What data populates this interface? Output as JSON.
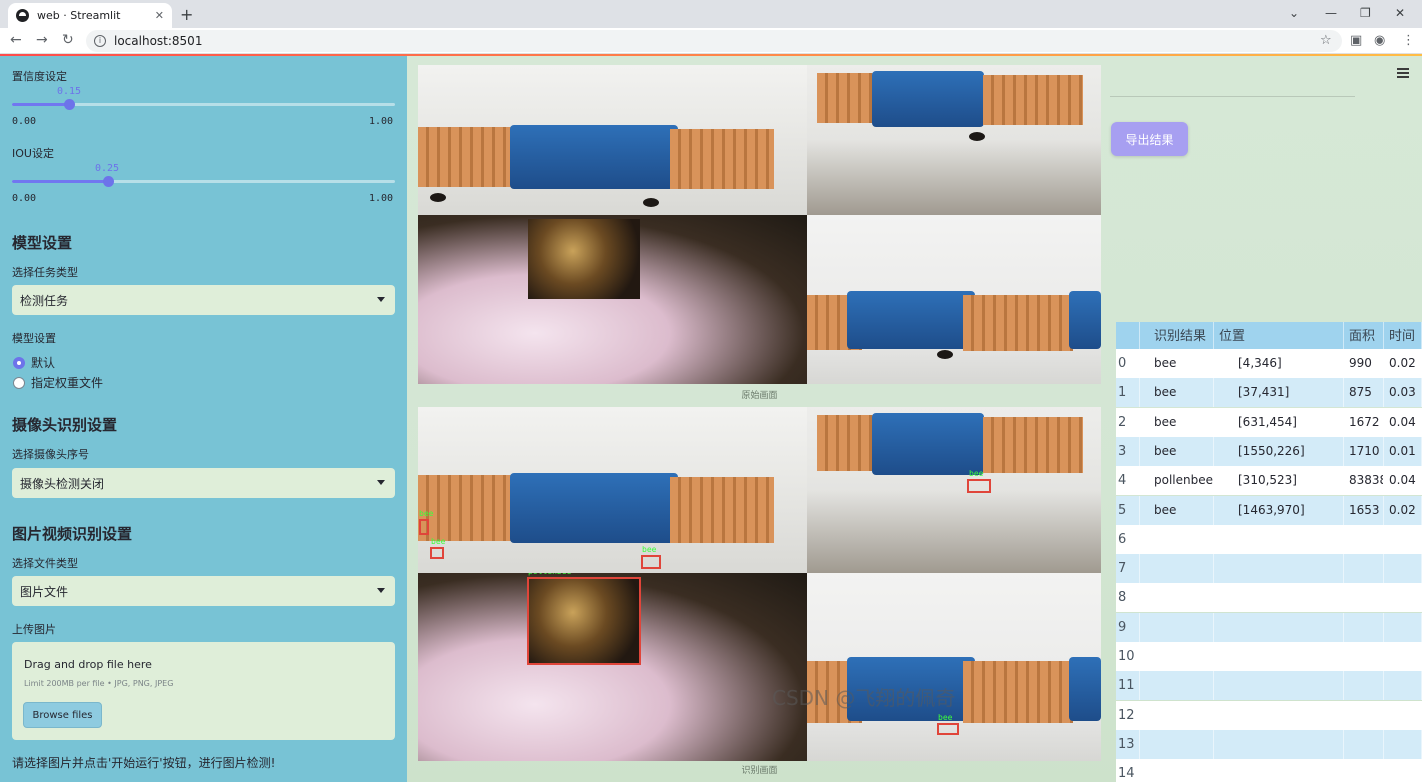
{
  "browser": {
    "tab_title": "web · Streamlit",
    "url": "localhost:8501"
  },
  "sidebar": {
    "conf_label": "置信度设定",
    "conf_value": "0.15",
    "conf_min": "0.00",
    "conf_max": "1.00",
    "iou_label": "IOU设定",
    "iou_value": "0.25",
    "iou_min": "0.00",
    "iou_max": "1.00",
    "model_header": "模型设置",
    "task_label": "选择任务类型",
    "task_value": "检测任务",
    "model_label": "模型设置",
    "radio_default": "默认",
    "radio_custom": "指定权重文件",
    "camera_header": "摄像头识别设置",
    "camera_label": "选择摄像头序号",
    "camera_value": "摄像头检测关闭",
    "file_header": "图片视频识别设置",
    "filetype_label": "选择文件类型",
    "filetype_value": "图片文件",
    "upload_label": "上传图片",
    "drag_text": "Drag and drop file here",
    "limit_text": "Limit 200MB per file • JPG, PNG, JPEG",
    "browse_label": "Browse files",
    "hint": "请选择图片并点击'开始运行'按钮，进行图片检测!"
  },
  "main": {
    "caption_original": "原始画面",
    "caption_result": "识别画面",
    "export_label": "导出结果",
    "det_labels": [
      "bee",
      "bee",
      "bee",
      "bee",
      "pollenbee",
      "bee"
    ]
  },
  "table": {
    "headers": [
      "识别结果",
      "位置",
      "面积",
      "时间"
    ],
    "rows": [
      {
        "idx": "0",
        "name": "bee",
        "pos": "[4,346]",
        "area": "990",
        "time": "0.02"
      },
      {
        "idx": "1",
        "name": "bee",
        "pos": "[37,431]",
        "area": "875",
        "time": "0.03"
      },
      {
        "idx": "2",
        "name": "bee",
        "pos": "[631,454]",
        "area": "1672",
        "time": "0.04"
      },
      {
        "idx": "3",
        "name": "bee",
        "pos": "[1550,226]",
        "area": "1710",
        "time": "0.01"
      },
      {
        "idx": "4",
        "name": "pollenbee",
        "pos": "[310,523]",
        "area": "83838",
        "time": "0.04"
      },
      {
        "idx": "5",
        "name": "bee",
        "pos": "[1463,970]",
        "area": "1653",
        "time": "0.02"
      },
      {
        "idx": "6",
        "name": "",
        "pos": "",
        "area": "",
        "time": ""
      },
      {
        "idx": "7",
        "name": "",
        "pos": "",
        "area": "",
        "time": ""
      },
      {
        "idx": "8",
        "name": "",
        "pos": "",
        "area": "",
        "time": ""
      },
      {
        "idx": "9",
        "name": "",
        "pos": "",
        "area": "",
        "time": ""
      },
      {
        "idx": "10",
        "name": "",
        "pos": "",
        "area": "",
        "time": ""
      },
      {
        "idx": "11",
        "name": "",
        "pos": "",
        "area": "",
        "time": ""
      },
      {
        "idx": "12",
        "name": "",
        "pos": "",
        "area": "",
        "time": ""
      },
      {
        "idx": "13",
        "name": "",
        "pos": "",
        "area": "",
        "time": ""
      },
      {
        "idx": "14",
        "name": "",
        "pos": "",
        "area": "",
        "time": ""
      }
    ]
  },
  "watermark": "CSDN @飞翔的佩奇"
}
